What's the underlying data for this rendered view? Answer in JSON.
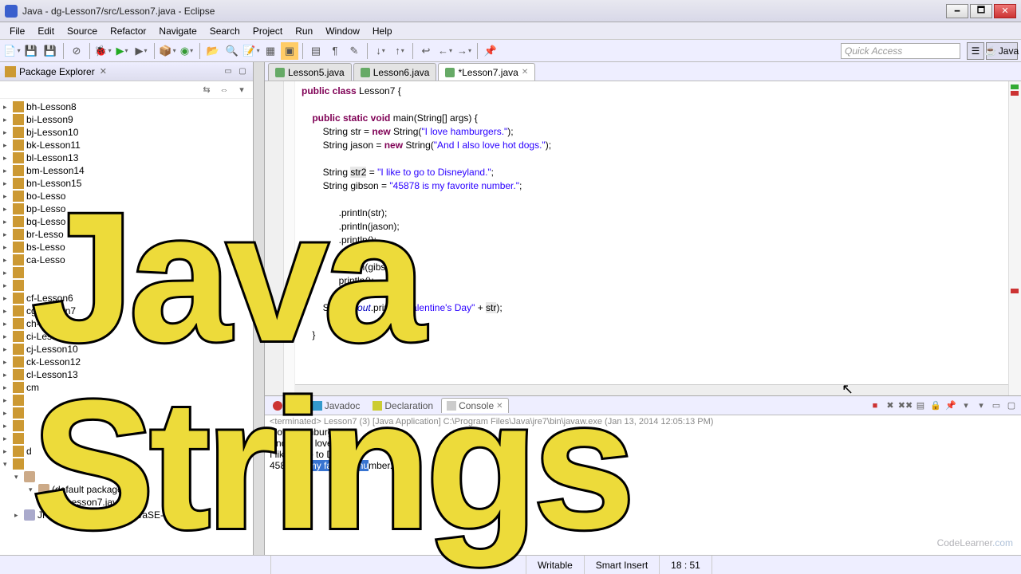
{
  "window": {
    "title": "Java - dg-Lesson7/src/Lesson7.java - Eclipse",
    "minimize": "🗕",
    "maximize": "🗖",
    "close": "✕"
  },
  "menu": [
    "File",
    "Edit",
    "Source",
    "Refactor",
    "Navigate",
    "Search",
    "Project",
    "Run",
    "Window",
    "Help"
  ],
  "toolbar": {
    "quick_access_placeholder": "Quick Access",
    "java_persp": "Java"
  },
  "explorer": {
    "title": "Package Explorer",
    "items": [
      {
        "label": "bh-Lesson8",
        "depth": 0,
        "state": "collapsed"
      },
      {
        "label": "bi-Lesson9",
        "depth": 0,
        "state": "collapsed"
      },
      {
        "label": "bj-Lesson10",
        "depth": 0,
        "state": "collapsed"
      },
      {
        "label": "bk-Lesson11",
        "depth": 0,
        "state": "collapsed"
      },
      {
        "label": "bl-Lesson13",
        "depth": 0,
        "state": "collapsed"
      },
      {
        "label": "bm-Lesson14",
        "depth": 0,
        "state": "collapsed"
      },
      {
        "label": "bn-Lesson15",
        "depth": 0,
        "state": "collapsed"
      },
      {
        "label": "bo-Lesso",
        "depth": 0,
        "state": "collapsed"
      },
      {
        "label": "bp-Lesso",
        "depth": 0,
        "state": "collapsed"
      },
      {
        "label": "bq-Lesso",
        "depth": 0,
        "state": "collapsed"
      },
      {
        "label": "br-Lesso",
        "depth": 0,
        "state": "collapsed"
      },
      {
        "label": "bs-Lesso",
        "depth": 0,
        "state": "collapsed"
      },
      {
        "label": "ca-Lesso",
        "depth": 0,
        "state": "collapsed"
      },
      {
        "label": "",
        "depth": 0,
        "state": "collapsed"
      },
      {
        "label": "",
        "depth": 0,
        "state": "collapsed"
      },
      {
        "label": "cf-Lesson6",
        "depth": 0,
        "state": "collapsed"
      },
      {
        "label": "cg-Lesson7",
        "depth": 0,
        "state": "collapsed"
      },
      {
        "label": "ch-Lesson8",
        "depth": 0,
        "state": "collapsed"
      },
      {
        "label": "ci-Lesson9",
        "depth": 0,
        "state": "collapsed"
      },
      {
        "label": "cj-Lesson10",
        "depth": 0,
        "state": "collapsed"
      },
      {
        "label": "ck-Lesson12",
        "depth": 0,
        "state": "collapsed"
      },
      {
        "label": "cl-Lesson13",
        "depth": 0,
        "state": "collapsed"
      },
      {
        "label": "cm",
        "depth": 0,
        "state": "collapsed"
      },
      {
        "label": "",
        "depth": 0,
        "state": "collapsed"
      },
      {
        "label": "",
        "depth": 0,
        "state": "collapsed"
      },
      {
        "label": "",
        "depth": 0,
        "state": "collapsed"
      },
      {
        "label": "",
        "depth": 0,
        "state": "collapsed"
      },
      {
        "label": "d",
        "depth": 0,
        "state": "collapsed"
      },
      {
        "label": "",
        "depth": 0,
        "state": "expanded"
      },
      {
        "label": "",
        "depth": 1,
        "state": "expanded",
        "icon": "pkg"
      },
      {
        "label": "(default package)",
        "depth": 2,
        "state": "expanded",
        "icon": "pkg"
      },
      {
        "label": "Lesson7.java",
        "depth": 3,
        "state": "leaf",
        "icon": "java"
      },
      {
        "label": "JRE System Library [JavaSE-1.7]",
        "depth": 1,
        "state": "collapsed",
        "icon": "lib"
      }
    ]
  },
  "tabs": [
    {
      "label": "Lesson5.java",
      "active": false,
      "dirty": false
    },
    {
      "label": "Lesson6.java",
      "active": false,
      "dirty": false
    },
    {
      "label": "*Lesson7.java",
      "active": true,
      "dirty": true
    }
  ],
  "code": {
    "l1a": "public class",
    "l1b": " Lesson7 {",
    "l2a": "    public static void",
    "l2b": " main(String[] args) {",
    "l3a": "        String str = ",
    "l3b": "new",
    "l3c": " String(",
    "l3d": "\"I love hamburgers.\"",
    "l3e": ");",
    "l4a": "        String jason = ",
    "l4b": "new",
    "l4c": " String(",
    "l4d": "\"And I also love hot dogs.\"",
    "l4e": ");",
    "l5": "",
    "l6a": "        String ",
    "l6b": "str2",
    "l6c": " = ",
    "l6d": "\"I like to go to Disneyland.\"",
    "l6e": ";",
    "l7a": "        String gibson = ",
    "l7b": "\"45878 is my favorite number.\"",
    "l7c": ";",
    "l8": "",
    "l9": "              .println(str);",
    "l10": "              .println(jason);",
    "l11": "              .println();",
    "l12a": "              .println(",
    "l12b": "str2",
    "l12c": ");",
    "l13": "              println(gibson);",
    "l14": "              println();",
    "l15": "",
    "l16a": "        System.",
    "l16b": "out",
    "l16c": ".println(",
    "l16d": "\"Valentine's Day\"",
    "l16e": " + ",
    "l16f": "str",
    "l16g": ");",
    "l17": "",
    "l18": "    }"
  },
  "bottom_tabs": {
    "problems": "Pro",
    "javadoc": "Javadoc",
    "declaration": "Declaration",
    "console": "Console"
  },
  "console": {
    "term_info": "<terminated> Lesson7 (3) [Java Application] C:\\Program Files\\Java\\jre7\\bin\\javaw.exe (Jan 13, 2014 12:05:13 PM)",
    "out1": "I love hamburgers.",
    "out2": "And I also love hot dogs.",
    "out3": "",
    "out4": "I like to go to Disneyl",
    "out5a": "458",
    "out5b": "78 is my favorite nu",
    "out5c": "mber."
  },
  "status": {
    "writable": "Writable",
    "insert": "Smart Insert",
    "pos": "18 : 51"
  },
  "overlay": {
    "line1": "Java",
    "line2": "Strings"
  },
  "watermark": {
    "brand": "CodeLearner",
    "tld": ".com"
  }
}
